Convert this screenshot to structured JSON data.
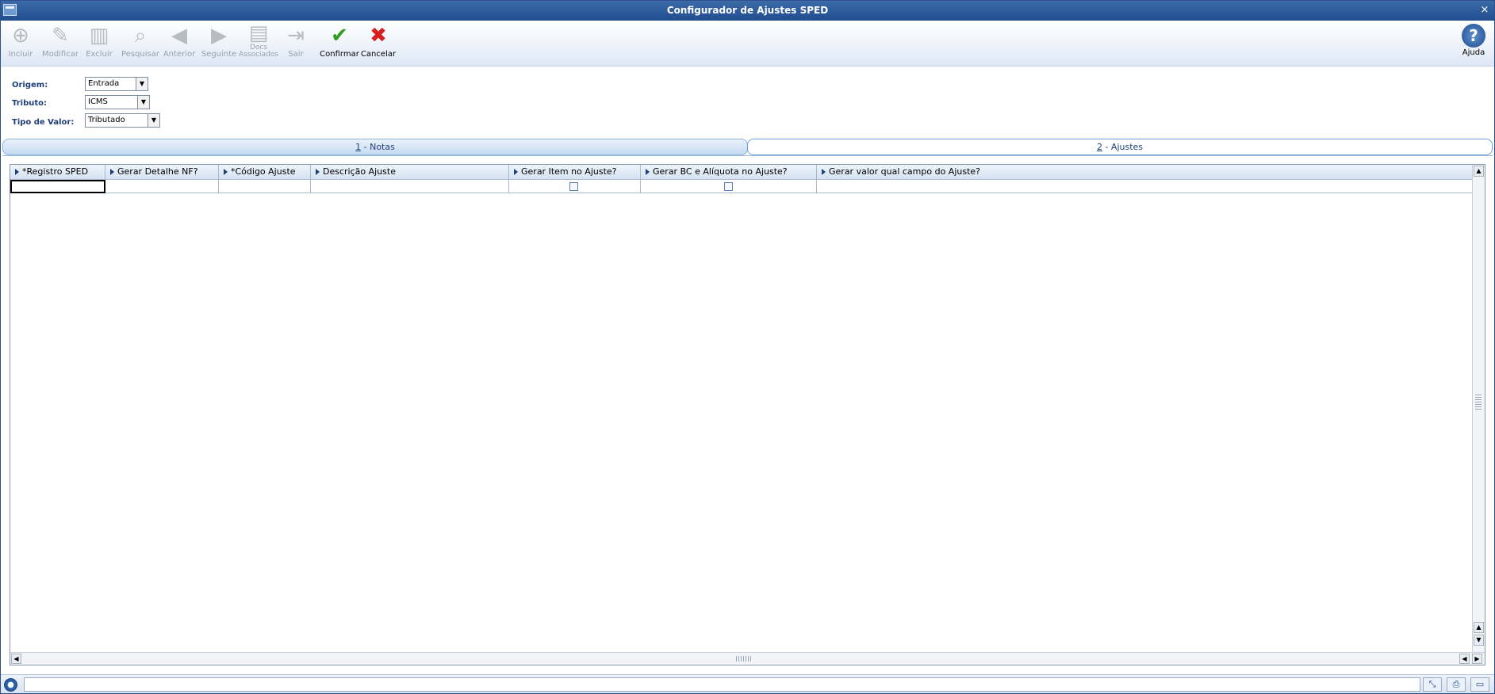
{
  "window": {
    "title": "Configurador de Ajustes SPED",
    "close_glyph": "×"
  },
  "toolbar": {
    "buttons": [
      {
        "label": "Incluir",
        "icon": "add-icon",
        "enabled": false
      },
      {
        "label": "Modificar",
        "icon": "edit-icon",
        "enabled": false
      },
      {
        "label": "Excluir",
        "icon": "trash-icon",
        "enabled": false
      },
      {
        "label": "Pesquisar",
        "icon": "search-icon",
        "enabled": false
      },
      {
        "label": "Anterior",
        "icon": "arrow-left-icon",
        "enabled": false
      },
      {
        "label": "Seguinte",
        "icon": "arrow-right-icon",
        "enabled": false
      },
      {
        "label_line1": "Docs",
        "label_line2": "Associados",
        "icon": "documents-icon",
        "enabled": false
      },
      {
        "label": "Sair",
        "icon": "exit-icon",
        "enabled": false
      },
      {
        "label": "Confirmar",
        "icon": "check-icon",
        "enabled": true,
        "color": "#2e9a1f"
      },
      {
        "label": "Cancelar",
        "icon": "cancel-icon",
        "enabled": true,
        "color": "#d81e1e"
      }
    ],
    "help": {
      "label": "Ajuda",
      "icon": "help-icon",
      "color": "#1f4d8e"
    }
  },
  "form": {
    "origem": {
      "label": "Origem:",
      "value": "Entrada"
    },
    "tributo": {
      "label": "Tributo:",
      "value": "ICMS"
    },
    "tipo_valor": {
      "label": "Tipo de Valor:",
      "value": "Tributado"
    }
  },
  "tabs": [
    {
      "key": "1",
      "label": " - Notas",
      "active": false
    },
    {
      "key": "2",
      "label": " - Ajustes",
      "active": true
    }
  ],
  "grid": {
    "columns": [
      "*Registro SPED",
      "Gerar Detalhe NF?",
      "*Código Ajuste",
      "Descrição Ajuste",
      "Gerar Item no Ajuste?",
      "Gerar BC e Alíquota no Ajuste?",
      "Gerar valor qual campo do Ajuste?"
    ],
    "rows": [
      {
        "registro_sped": "",
        "gerar_detalhe_nf": "",
        "codigo_ajuste": "",
        "descricao_ajuste": "",
        "gerar_item": false,
        "gerar_bc_aliquota": false,
        "gerar_valor_campo": ""
      }
    ]
  },
  "colors": {
    "accent": "#1f4d8e",
    "label": "#1f3f78"
  }
}
